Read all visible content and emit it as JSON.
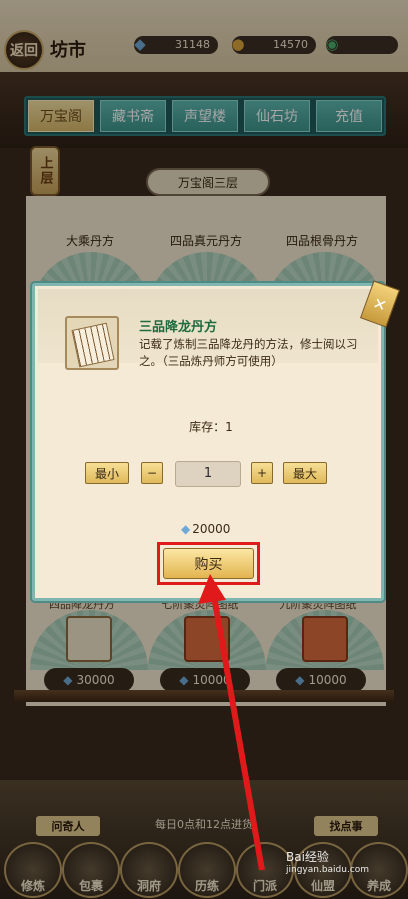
{
  "topbar": {
    "back_label": "返回",
    "title": "坊市",
    "resources": [
      {
        "icon": "spirit-stone-icon",
        "value": "31148"
      },
      {
        "icon": "treasure-bag-icon",
        "value": "14570"
      },
      {
        "icon": "jade-coin-icon",
        "value": ""
      }
    ]
  },
  "tabs": [
    "万宝阁",
    "藏书斋",
    "声望楼",
    "仙石坊",
    "充值"
  ],
  "floor": {
    "badge": "上层",
    "plate": "万宝阁三层"
  },
  "shop": {
    "top_items": [
      "大乘丹方",
      "四品真元丹方",
      "四品根骨丹方"
    ],
    "bottom_items": [
      {
        "name": "四品降龙丹方",
        "price": "30000"
      },
      {
        "name": "七阶聚灵阵图纸",
        "price": "10000"
      },
      {
        "name": "九阶聚灵阵图纸",
        "price": "10000"
      }
    ]
  },
  "modal": {
    "item_title": "三品降龙丹方",
    "item_desc": "记载了炼制三品降龙丹的方法，修士阅以习之。（三品炼丹师方可使用）",
    "stock": "库存：1",
    "min_label": "最小",
    "minus_label": "−",
    "quantity": "1",
    "plus_label": "+",
    "max_label": "最大",
    "cost": "20000",
    "buy_label": "购买",
    "close_label": "✕"
  },
  "bottom": {
    "refresh_note": "每日0点和12点进货",
    "left_sign": "问奇人",
    "right_sign": "找点事",
    "nav": [
      "修炼",
      "包裹",
      "洞府",
      "历练",
      "门派",
      "仙盟",
      "养成"
    ]
  },
  "watermark": {
    "brand": "Bai经验",
    "url": "jingyan.baidu.com"
  },
  "colors": {
    "highlight": "#e01a1a",
    "tab_active": "#d9b86a",
    "tab_default": "#3f958c"
  }
}
